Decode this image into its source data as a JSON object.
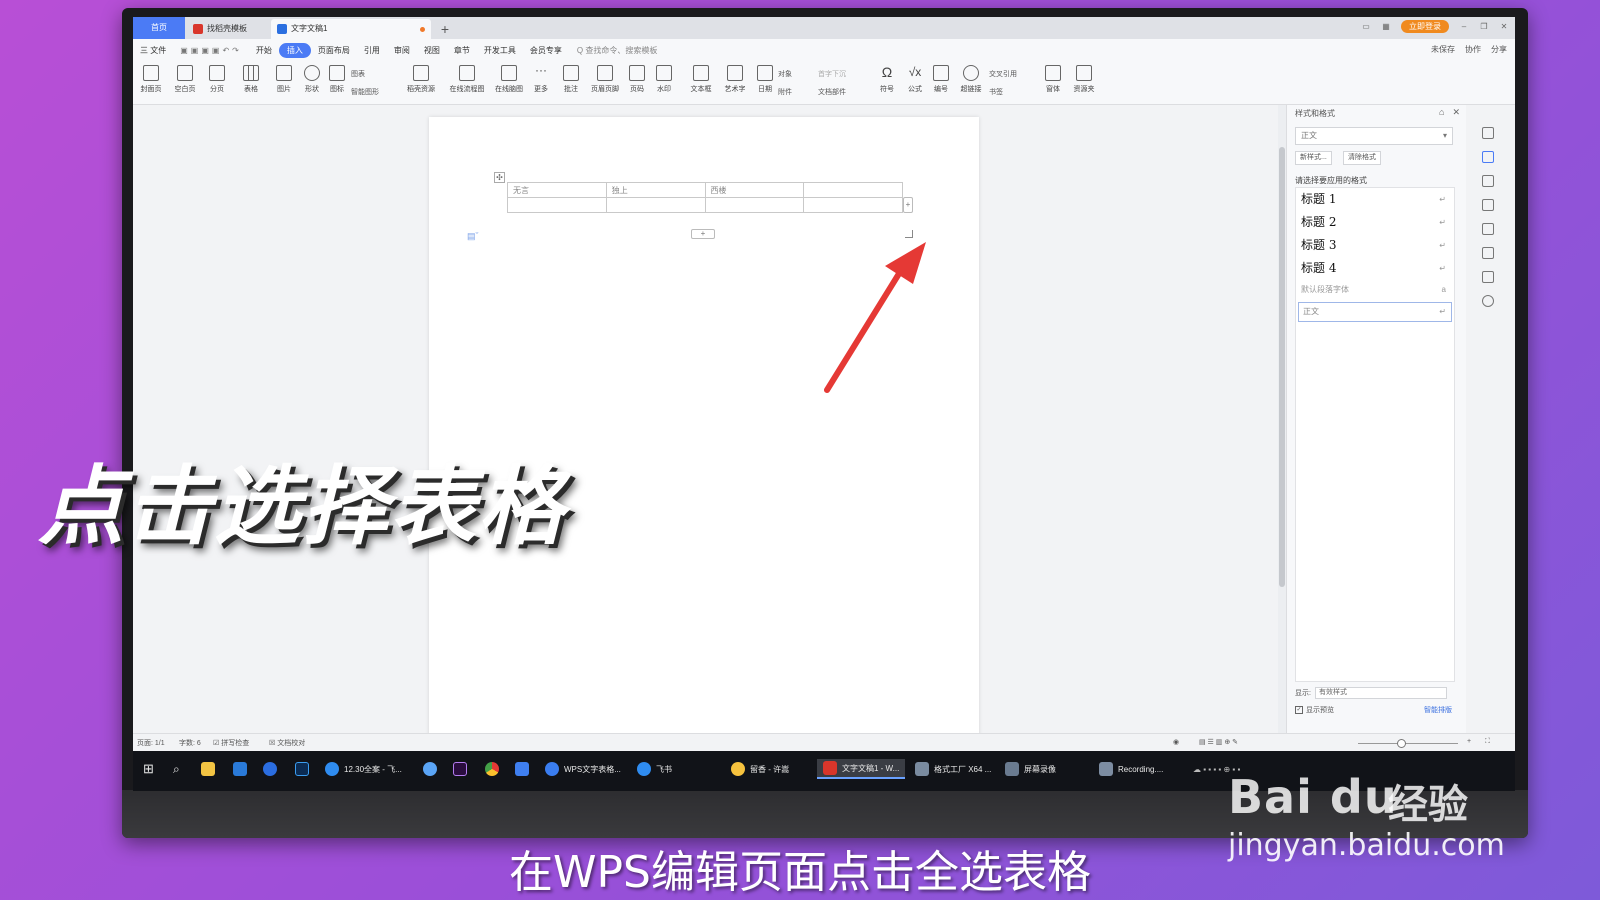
{
  "window": {
    "tabs": [
      {
        "label": "首页"
      },
      {
        "label": "找稻壳模板"
      },
      {
        "label": "文字文稿1"
      }
    ],
    "add_tab": "+",
    "login_button": "立即登录"
  },
  "menu": {
    "items": [
      "三 文件",
      "开始",
      "插入",
      "页面布局",
      "引用",
      "审阅",
      "视图",
      "章节",
      "开发工具",
      "会员专享"
    ],
    "active": "插入",
    "search_placeholder": "Q 查找命令、搜索模板",
    "right": [
      "未保存",
      "协作",
      "分享"
    ]
  },
  "ribbon": {
    "buttons": [
      {
        "label": "封面页"
      },
      {
        "label": "空白页"
      },
      {
        "label": "分页"
      },
      {
        "label": "表格"
      },
      {
        "label": "图片"
      },
      {
        "label": "形状"
      },
      {
        "label": "图标"
      },
      {
        "label": "稻壳资源"
      },
      {
        "label": "在线流程图"
      },
      {
        "label": "在线脑图"
      },
      {
        "label": "更多"
      },
      {
        "label": "批注"
      },
      {
        "label": "页眉页脚"
      },
      {
        "label": "页码"
      },
      {
        "label": "水印"
      },
      {
        "label": "文本框"
      },
      {
        "label": "艺术字"
      },
      {
        "label": "日期"
      },
      {
        "label": "符号"
      },
      {
        "label": "公式"
      },
      {
        "label": "编号"
      },
      {
        "label": "超链接"
      },
      {
        "label": "窗体"
      },
      {
        "label": "资源夹"
      }
    ],
    "small": {
      "chart": "图表",
      "smart_shape": "智能图形",
      "object": "对象",
      "attachment": "附件",
      "first_drop": "首字下沉",
      "doc_parts": "文档部件",
      "cross_ref": "交叉引用",
      "bookmark": "书签"
    }
  },
  "document": {
    "table": {
      "rows": [
        [
          "无言",
          "独上",
          "西楼",
          ""
        ],
        [
          "",
          "",
          "",
          ""
        ]
      ]
    },
    "add_col": "+",
    "add_row": "+"
  },
  "style_panel": {
    "title": "样式和格式",
    "current_style": "正文",
    "new_style_button": "新样式...",
    "clear_format_button": "清除格式",
    "apply_label": "请选择要应用的格式",
    "styles": [
      {
        "label": "标题 1"
      },
      {
        "label": "标题 2"
      },
      {
        "label": "标题 3"
      },
      {
        "label": "标题 4"
      }
    ],
    "default_font": "默认段落字体",
    "body_style": "正文",
    "show_label": "显示:",
    "show_value": "有效样式",
    "preview_label": "显示预览",
    "smart_label": "智能排版"
  },
  "statusbar": {
    "page": "页面: 1/1",
    "words": "字数: 6",
    "spellcheck": "拼写检查",
    "proofread": "文档校对"
  },
  "taskbar": {
    "apps": [
      {
        "label": "12.30全案 - 飞..."
      },
      {
        "label": "WPS文字表格..."
      },
      {
        "label": "飞书"
      },
      {
        "label": "留香 - 许嵩"
      },
      {
        "label": "文字文稿1 - W..."
      },
      {
        "label": "格式工厂 X64 ..."
      },
      {
        "label": "屏幕录像"
      },
      {
        "label": "Recording...."
      }
    ]
  },
  "overlay": {
    "caption": "点击选择表格",
    "subtitle": "在WPS编辑页面点击全选表格",
    "watermark_logo": "Bai du",
    "watermark_jingyan": "经验",
    "watermark_url": "jingyan.baidu.com",
    "arrow_color": "#e53935"
  },
  "colors": {
    "accent": "#4b7bf5",
    "background": "#a94fd7"
  }
}
